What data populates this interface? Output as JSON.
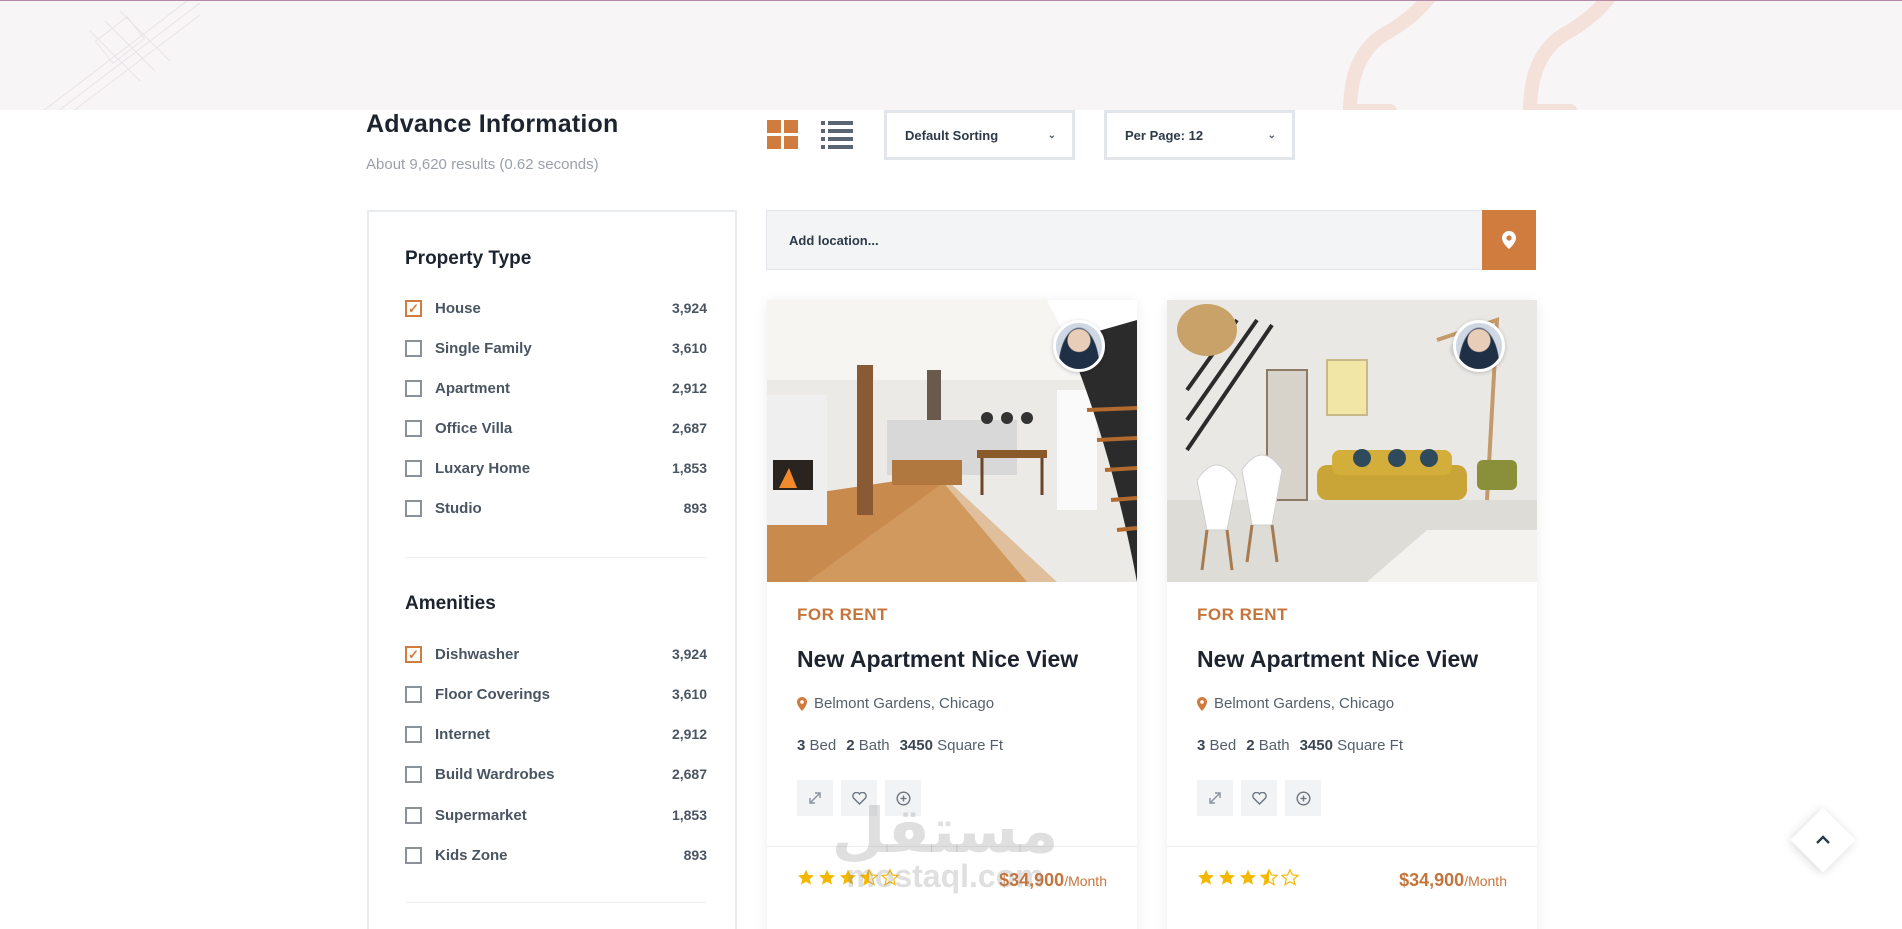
{
  "header": {
    "title": "Advance Information",
    "results": "About 9,620 results (0.62 seconds)"
  },
  "toolbar": {
    "grid_icon": "grid-view-icon",
    "list_icon": "list-view-icon",
    "sort_value": "Default Sorting",
    "perpage_value": "Per Page: 12"
  },
  "location": {
    "placeholder": "Add location...",
    "button_icon": "map-pin-icon"
  },
  "sidebar": {
    "property_heading": "Property Type",
    "property_types": [
      {
        "label": "House",
        "count": "3,924",
        "checked": true
      },
      {
        "label": "Single Family",
        "count": "3,610",
        "checked": false
      },
      {
        "label": "Apartment",
        "count": "2,912",
        "checked": false
      },
      {
        "label": "Office Villa",
        "count": "2,687",
        "checked": false
      },
      {
        "label": "Luxary Home",
        "count": "1,853",
        "checked": false
      },
      {
        "label": "Studio",
        "count": "893",
        "checked": false
      }
    ],
    "amenities_heading": "Amenities",
    "amenities": [
      {
        "label": "Dishwasher",
        "count": "3,924",
        "checked": true
      },
      {
        "label": "Floor Coverings",
        "count": "3,610",
        "checked": false
      },
      {
        "label": "Internet",
        "count": "2,912",
        "checked": false
      },
      {
        "label": "Build Wardrobes",
        "count": "2,687",
        "checked": false
      },
      {
        "label": "Supermarket",
        "count": "1,853",
        "checked": false
      },
      {
        "label": "Kids Zone",
        "count": "893",
        "checked": false
      }
    ]
  },
  "listings": [
    {
      "status": "FOR RENT",
      "title": "New Apartment Nice View",
      "location": "Belmont Gardens, Chicago",
      "beds": "3",
      "beds_label": "Bed",
      "baths": "2",
      "baths_label": "Bath",
      "area": "3450",
      "area_label": "Square Ft",
      "rating": 3.5,
      "price": "$34,900",
      "price_unit": "/Month"
    },
    {
      "status": "FOR RENT",
      "title": "New Apartment Nice View",
      "location": "Belmont Gardens, Chicago",
      "beds": "3",
      "beds_label": "Bed",
      "baths": "2",
      "baths_label": "Bath",
      "area": "3450",
      "area_label": "Square Ft",
      "rating": 3.5,
      "price": "$34,900",
      "price_unit": "/Month"
    }
  ],
  "watermark": {
    "arabic": "مستقل",
    "latin": "mostaql.com"
  },
  "colors": {
    "accent": "#d07c3f",
    "star": "#f5b800",
    "text_dark": "#1d2430",
    "muted": "#9aa1ab"
  }
}
